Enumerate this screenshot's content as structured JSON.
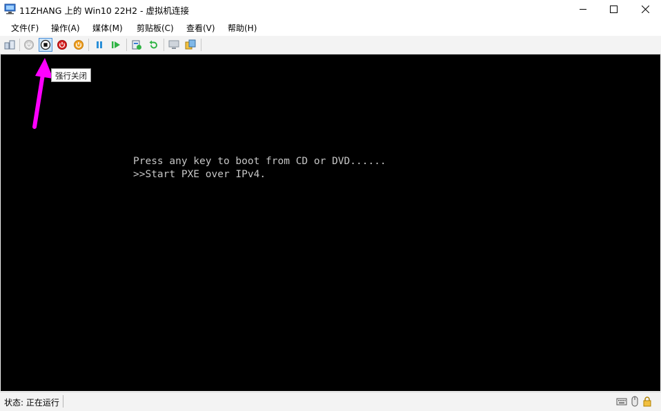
{
  "window": {
    "title": "11ZHANG 上的 Win10 22H2 - 虚拟机连接"
  },
  "menu": {
    "items": [
      {
        "label": "文件(F)"
      },
      {
        "label": "操作(A)"
      },
      {
        "label": "媒体(M)"
      },
      {
        "label": "剪贴板(C)"
      },
      {
        "label": "查看(V)"
      },
      {
        "label": "帮助(H)"
      }
    ]
  },
  "toolbar": {
    "buttons": [
      {
        "icon": "ctrl-alt-del-icon"
      },
      {
        "icon": "start-icon"
      },
      {
        "icon": "turn-off-icon",
        "pressed": true
      },
      {
        "icon": "shut-down-icon"
      },
      {
        "icon": "save-icon"
      },
      {
        "icon": "pause-icon"
      },
      {
        "icon": "resume-icon"
      },
      {
        "icon": "checkpoint-icon"
      },
      {
        "icon": "revert-icon"
      },
      {
        "icon": "enhanced-session-icon"
      },
      {
        "icon": "share-icon"
      }
    ],
    "tooltip": "强行关闭"
  },
  "console": {
    "lines": [
      "Press any key to boot from CD or DVD......",
      ">>Start PXE over IPv4."
    ],
    "background": "#000000",
    "text_color": "#c6c6c6"
  },
  "annotation": {
    "color": "#ff00ff"
  },
  "status": {
    "text": "状态: 正在运行"
  }
}
